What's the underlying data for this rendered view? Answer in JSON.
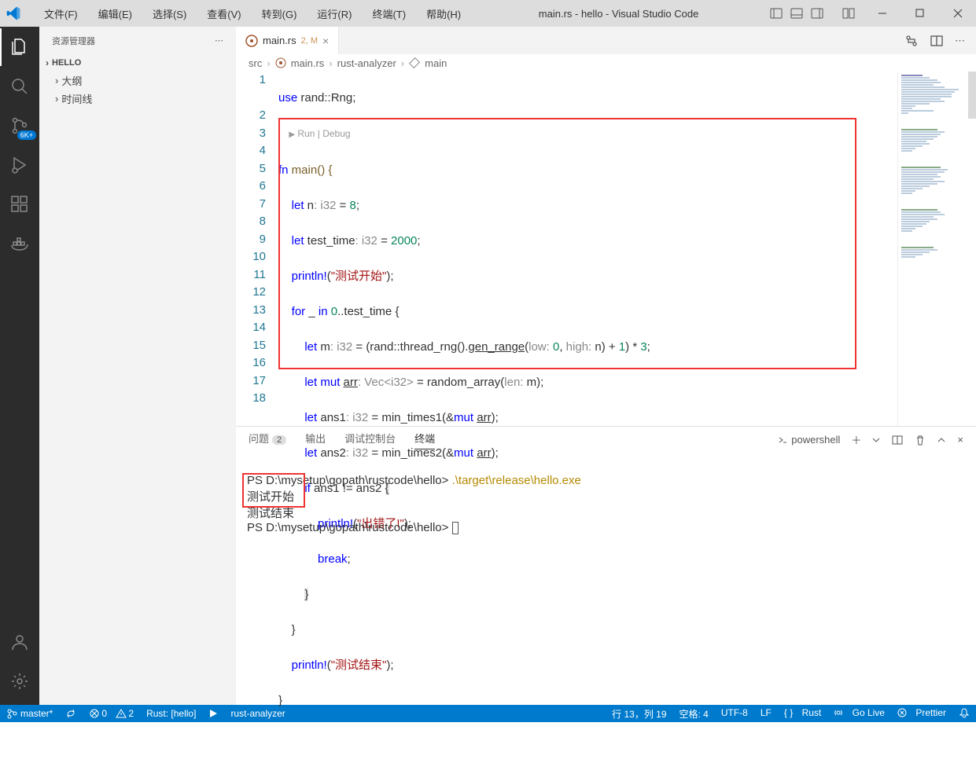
{
  "title": "main.rs - hello - Visual Studio Code",
  "menu": [
    "文件(F)",
    "编辑(E)",
    "选择(S)",
    "查看(V)",
    "转到(G)",
    "运行(R)",
    "终端(T)",
    "帮助(H)"
  ],
  "activity_badge": "6K+",
  "sidebar": {
    "title": "资源管理器",
    "sections": [
      "HELLO",
      "大纲",
      "时间线"
    ]
  },
  "tab": {
    "filename": "main.rs",
    "modified": "2, M"
  },
  "breadcrumb": {
    "a": "src",
    "b": "main.rs",
    "c": "rust-analyzer",
    "d": "main"
  },
  "codelens": "Run | Debug",
  "lines": [
    "1",
    "2",
    "3",
    "4",
    "5",
    "6",
    "7",
    "8",
    "9",
    "10",
    "11",
    "12",
    "13",
    "14",
    "15",
    "16",
    "17",
    "18"
  ],
  "code": {
    "l1a": "use",
    "l1b": " rand::Rng;",
    "l2a": "fn",
    "l2b": " main() {",
    "l3a": "let",
    "l3b": " n",
    "l3c": ": i32",
    "l3d": " = ",
    "l3e": "8",
    "l3f": ";",
    "l4a": "let",
    "l4b": " test_time",
    "l4c": ": i32",
    "l4d": " = ",
    "l4e": "2000",
    "l4f": ";",
    "l5a": "println!",
    "l5b": "(",
    "l5c": "\"测试开始\"",
    "l5d": ");",
    "l6a": "for",
    "l6b": " _ ",
    "l6c": "in",
    "l6d": " ",
    "l6e": "0",
    "l6f": "..test_time {",
    "l7a": "let",
    "l7b": " m",
    "l7c": ": i32",
    "l7d": " = (rand::thread_rng().",
    "l7e": "gen_range",
    "l7f": "(",
    "l7g": "low:",
    "l7h": " ",
    "l7i": "0",
    "l7j": ", ",
    "l7k": "high:",
    "l7l": " n) + ",
    "l7m": "1",
    "l7n": ") * ",
    "l7o": "3",
    "l7p": ";",
    "l8a": "let",
    "l8b": " ",
    "l8c": "mut",
    "l8d": " ",
    "l8e": "arr",
    "l8f": ": Vec<i32>",
    "l8g": " = random_array(",
    "l8h": "len:",
    "l8i": " m);",
    "l9a": "let",
    "l9b": " ans1",
    "l9c": ": i32",
    "l9d": " = min_times1(&",
    "l9e": "mut",
    "l9f": " ",
    "l9g": "arr",
    "l9h": ");",
    "l10a": "let",
    "l10b": " ans2",
    "l10c": ": i32",
    "l10d": " = min_times2(&",
    "l10e": "mut",
    "l10f": " ",
    "l10g": "arr",
    "l10h": ");",
    "l11a": "if",
    "l11b": " ans1 != ans2 ",
    "l11c": "{",
    "l12a": "println!",
    "l12b": "(",
    "l12c": "\"出错了!\"",
    "l12d": ");",
    "l13a": "break",
    "l13b": ";",
    "l14": "}",
    "l15": "}",
    "l16a": "println!",
    "l16b": "(",
    "l16c": "\"测试结束\"",
    "l16d": ");",
    "l17": "}"
  },
  "panel": {
    "tabs": {
      "problems": "问题",
      "problems_count": "2",
      "output": "输出",
      "debug": "调试控制台",
      "terminal": "终端"
    },
    "shell": "powershell"
  },
  "terminal": {
    "prompt1": "PS D:\\mysetup\\gopath\\rustcode\\hello> ",
    "cmd1": ".\\target\\release\\hello.exe",
    "out1": "测试开始",
    "out2": "测试结束",
    "prompt2": "PS D:\\mysetup\\gopath\\rustcode\\hello> "
  },
  "status": {
    "branch": "master*",
    "errors": "0",
    "warnings": "2",
    "rust": "Rust: [hello]",
    "analyzer": "rust-analyzer",
    "pos": "行 13，列 19",
    "spaces": "空格: 4",
    "encoding": "UTF-8",
    "eol": "LF",
    "lang": "Rust",
    "golive": "Go Live",
    "prettier": "Prettier"
  }
}
